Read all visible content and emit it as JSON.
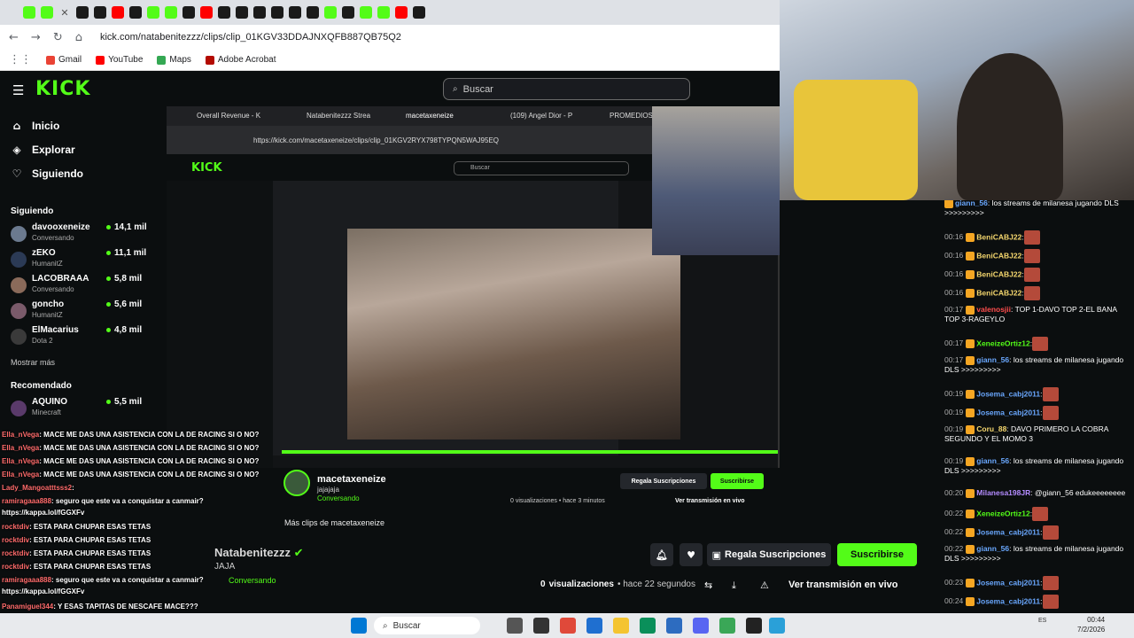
{
  "browser": {
    "url": "kick.com/natabenitezzz/clips/clip_01KGV33DDAJNXQFB887QB75Q2",
    "bookmarks": [
      "Gmail",
      "YouTube",
      "Maps",
      "Adobe Acrobat"
    ]
  },
  "header": {
    "logo": "KICK",
    "search_placeholder": "Buscar"
  },
  "sidebar": {
    "nav": [
      {
        "label": "Inicio",
        "icon": "home-icon"
      },
      {
        "label": "Explorar",
        "icon": "compass-icon"
      },
      {
        "label": "Siguiendo",
        "icon": "heart-icon"
      }
    ],
    "following_title": "Siguiendo",
    "following": [
      {
        "name": "davooxeneize",
        "sub": "Conversando",
        "count": "14,1 mil"
      },
      {
        "name": "zEKO",
        "sub": "HumanitZ",
        "count": "11,1 mil"
      },
      {
        "name": "LACOBRAAA",
        "sub": "Conversando",
        "count": "5,8 mil"
      },
      {
        "name": "goncho",
        "sub": "HumanitZ",
        "count": "5,6 mil"
      },
      {
        "name": "ElMacarius",
        "sub": "Dota 2",
        "count": "4,8 mil"
      }
    ],
    "show_more": "Mostrar más",
    "recommended_title": "Recomendado",
    "recommended": [
      {
        "name": "AQUINO",
        "sub": "Minecraft",
        "count": "5,5 mil"
      }
    ]
  },
  "stream": {
    "inner_url": "https://kick.com/macetaxeneize/clips/clip_01KGV2RYX798TYPQN5WAJ95EQ",
    "inner_tabs": [
      "Overall Revenue - K",
      "Natabenitezzz Strea",
      "macetaxeneize",
      "(109) Angel Dior - P",
      "PROMEDIOS"
    ],
    "clip_channel": "macetaxeneize",
    "clip_title": "jajajaja",
    "clip_sub": "Conversando",
    "clip_views": "0 visualizaciones • hace 3 minutos",
    "clip_gift": "Regala Suscripciones",
    "clip_sub_btn": "Suscribirse",
    "clip_live": "Ver transmisión en vivo",
    "more_clips": "Más clips de macetaxeneize"
  },
  "channel": {
    "name": "Natabenitezzz",
    "title": "JAJA",
    "category": "Conversando",
    "views_count": "0",
    "views_label": "visualizaciones",
    "time": "• hace 22 segundos",
    "gift_label": "Regala Suscripciones",
    "subscribe_label": "Suscribirse",
    "live_label": "Ver transmisión en vivo"
  },
  "overlay_chat": [
    {
      "user": "Ella_nVega",
      "msg": ": MACE ME DAS UNA ASISTENCIA CON LA DE RACING SI O NO?"
    },
    {
      "user": "Ella_nVega",
      "msg": ": MACE ME DAS UNA ASISTENCIA CON LA DE RACING SI O NO?"
    },
    {
      "user": "Ella_nVega",
      "msg": ": MACE ME DAS UNA ASISTENCIA CON LA DE RACING SI O NO?"
    },
    {
      "user": "Ella_nVega",
      "msg": ": MACE ME DAS UNA ASISTENCIA CON LA DE RACING SI O NO?"
    },
    {
      "user": "Lady_Mangoatttsss2",
      "msg": ":"
    },
    {
      "user": "ramiragaaa888",
      "msg": ": seguro que este va a conquistar a canmair?"
    },
    {
      "user": "",
      "msg": "https://kappa.lol/fGGXFv"
    },
    {
      "user": "rocktdiv",
      "msg": ": ESTA PARA CHUPAR ESAS TETAS"
    },
    {
      "user": "rocktdiv",
      "msg": ": ESTA PARA CHUPAR ESAS TETAS"
    },
    {
      "user": "rocktdiv",
      "msg": ": ESTA PARA CHUPAR ESAS TETAS"
    },
    {
      "user": "rocktdiv",
      "msg": ": ESTA PARA CHUPAR ESAS TETAS"
    },
    {
      "user": "ramiragaaa888",
      "msg": ": seguro que este va a conquistar a canmair?"
    },
    {
      "user": "",
      "msg": "https://kappa.lol/fGGXFv"
    },
    {
      "user": "Panamiguel344",
      "msg": ": Y ESAS TAPITAS DE NESCAFE MACE???"
    },
    {
      "user": "",
      "msg": ": seguro que este va a conquistar a canmair?"
    },
    {
      "user": "",
      "msg": "https://kappa.lol/fGGXFv"
    }
  ],
  "chat": [
    {
      "time": "",
      "user": "giann_56",
      "msg": ": los streams de milanesa jugando DLS >>>>>>>>>",
      "color": "#6aa8ff"
    },
    {
      "time": "00:16",
      "user": "BeniCABJ22",
      "msg": ":",
      "color": "#f5d76e",
      "emote": true
    },
    {
      "time": "00:16",
      "user": "BeniCABJ22",
      "msg": ":",
      "color": "#f5d76e",
      "emote": true
    },
    {
      "time": "00:16",
      "user": "BeniCABJ22",
      "msg": ":",
      "color": "#f5d76e",
      "emote": true
    },
    {
      "time": "00:16",
      "user": "BeniCABJ22",
      "msg": ":",
      "color": "#f5d76e",
      "emote": true
    },
    {
      "time": "00:17",
      "user": "valenosjii",
      "msg": ": TOP 1-DAVO TOP 2-EL BANA TOP 3-RAGEYLO",
      "color": "#ff4d4d"
    },
    {
      "time": "00:17",
      "user": "XeneizeOrtiz12",
      "msg": ":",
      "color": "#53fc18",
      "emote": true
    },
    {
      "time": "00:17",
      "user": "giann_56",
      "msg": ": los streams de milanesa jugando DLS >>>>>>>>>",
      "color": "#6aa8ff"
    },
    {
      "time": "00:19",
      "user": "Josema_cabj2011",
      "msg": ":",
      "color": "#6aa8ff",
      "emote": true
    },
    {
      "time": "00:19",
      "user": "Josema_cabj2011",
      "msg": ":",
      "color": "#6aa8ff",
      "emote": true
    },
    {
      "time": "00:19",
      "user": "Coru_88",
      "msg": ": DAVO PRIMERO LA COBRA SEGUNDO Y EL MOMO 3",
      "color": "#f5d76e"
    },
    {
      "time": "00:19",
      "user": "giann_56",
      "msg": ": los streams de milanesa jugando DLS >>>>>>>>>",
      "color": "#6aa8ff"
    },
    {
      "time": "00:20",
      "user": "Milanesa198JR",
      "msg": ": @giann_56 edukeeeeeeee",
      "color": "#b48cff"
    },
    {
      "time": "00:22",
      "user": "XeneizeOrtiz12",
      "msg": ":",
      "color": "#53fc18",
      "emote": true
    },
    {
      "time": "00:22",
      "user": "Josema_cabj2011",
      "msg": ":",
      "color": "#6aa8ff",
      "emote": true
    },
    {
      "time": "00:22",
      "user": "giann_56",
      "msg": ": los streams de milanesa jugando DLS >>>>>>>>>",
      "color": "#6aa8ff"
    },
    {
      "time": "00:23",
      "user": "Josema_cabj2011",
      "msg": ":",
      "color": "#6aa8ff",
      "emote": true
    },
    {
      "time": "00:24",
      "user": "Josema_cabj2011",
      "msg": ":",
      "color": "#6aa8ff",
      "emote": true
    }
  ],
  "taskbar": {
    "search": "Buscar",
    "time": "00:44",
    "date": "7/2/2026",
    "lang": "ES"
  },
  "colors": {
    "accent": "#53fc18",
    "bg": "#0b0e0f"
  }
}
